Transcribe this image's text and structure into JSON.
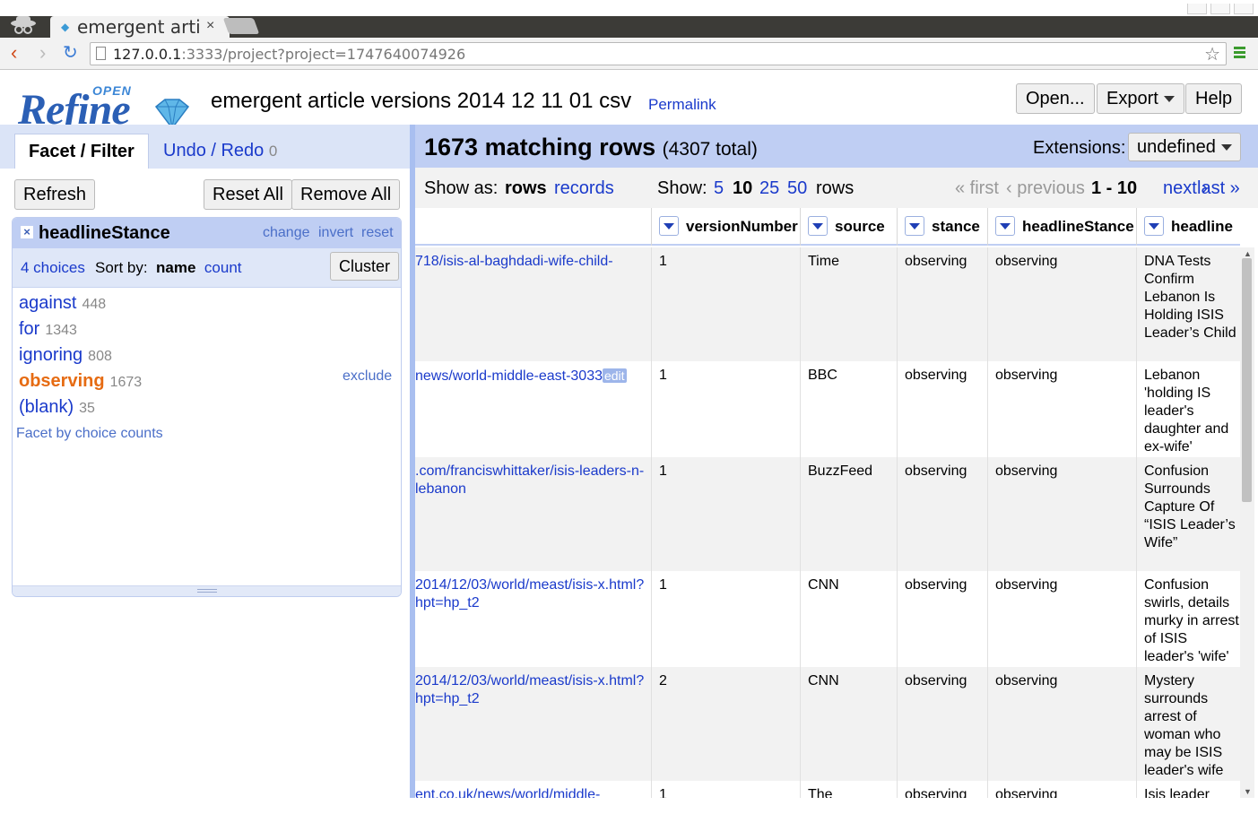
{
  "browser": {
    "tab_title": "emergent arti",
    "tab_close": "×",
    "url_host": "127.0.0.1",
    "url_rest": ":3333/project?project=1747640074926"
  },
  "header": {
    "logo_open": "OPEN",
    "logo_refine": "Refine",
    "project_title": "emergent article versions 2014 12 11 01 csv",
    "permalink": "Permalink",
    "open_btn": "Open...",
    "export_btn": "Export",
    "help_btn": "Help"
  },
  "left": {
    "tab_facet": "Facet / Filter",
    "tab_undo": "Undo / Redo",
    "undo_count": "0",
    "refresh": "Refresh",
    "reset_all": "Reset All",
    "remove_all": "Remove All",
    "facet": {
      "title": "headlineStance",
      "change": "change",
      "invert": "invert",
      "reset": "reset",
      "choices_count": "4 choices",
      "sort_by": "Sort by:",
      "sort_name": "name",
      "sort_count": "count",
      "cluster": "Cluster",
      "choices": [
        {
          "name": "against",
          "count": "448"
        },
        {
          "name": "for",
          "count": "1343"
        },
        {
          "name": "ignoring",
          "count": "808"
        },
        {
          "name": "observing",
          "count": "1673"
        },
        {
          "name": "(blank)",
          "count": "35"
        }
      ],
      "exclude": "exclude",
      "facet_by_counts": "Facet by choice counts"
    }
  },
  "right": {
    "matching": "1673 matching rows",
    "total": "(4307 total)",
    "extensions_label": "Extensions:",
    "extensions_value": "undefined",
    "show_as": "Show as:",
    "rows": "rows",
    "records": "records",
    "show": "Show:",
    "sizes": [
      "5",
      "10",
      "25",
      "50"
    ],
    "rows_word": "rows",
    "first": "« first",
    "previous": "‹ previous",
    "range": "1 - 10",
    "next": "next ›",
    "last": "last »",
    "columns": [
      "versionNumber",
      "source",
      "stance",
      "headlineStance",
      "headline"
    ],
    "rows_data": [
      {
        "url": "718/isis-al-baghdadi-wife-child-",
        "version": "1",
        "source": "Time",
        "stance": "observing",
        "hstance": "observing",
        "headline": "DNA Tests Confirm Lebanon Is Holding ISIS Leader’s Child"
      },
      {
        "url": "news/world-middle-east-3033",
        "edit": "edit",
        "version": "1",
        "source": "BBC",
        "stance": "observing",
        "hstance": "observing",
        "headline": "Lebanon 'holding IS leader's daughter and ex-wife'"
      },
      {
        "url": ".com/franciswhittaker/isis-leaders-n-lebanon",
        "version": "1",
        "source": "BuzzFeed",
        "stance": "observing",
        "hstance": "observing",
        "headline": "Confusion Surrounds Capture Of “ISIS Leader’s Wife”"
      },
      {
        "url": "2014/12/03/world/meast/isis-x.html?hpt=hp_t2",
        "version": "1",
        "source": "CNN",
        "stance": "observing",
        "hstance": "observing",
        "headline": "Confusion swirls, details murky in arrest of ISIS leader's 'wife'"
      },
      {
        "url": "2014/12/03/world/meast/isis-x.html?hpt=hp_t2",
        "version": "2",
        "source": "CNN",
        "stance": "observing",
        "hstance": "observing",
        "headline": "Mystery surrounds arrest of woman who may be ISIS leader's wife"
      },
      {
        "url": "ent.co.uk/news/world/middle-",
        "version": "1",
        "source": "The",
        "stance": "observing",
        "hstance": "observing",
        "headline": "Isis leader"
      }
    ]
  }
}
